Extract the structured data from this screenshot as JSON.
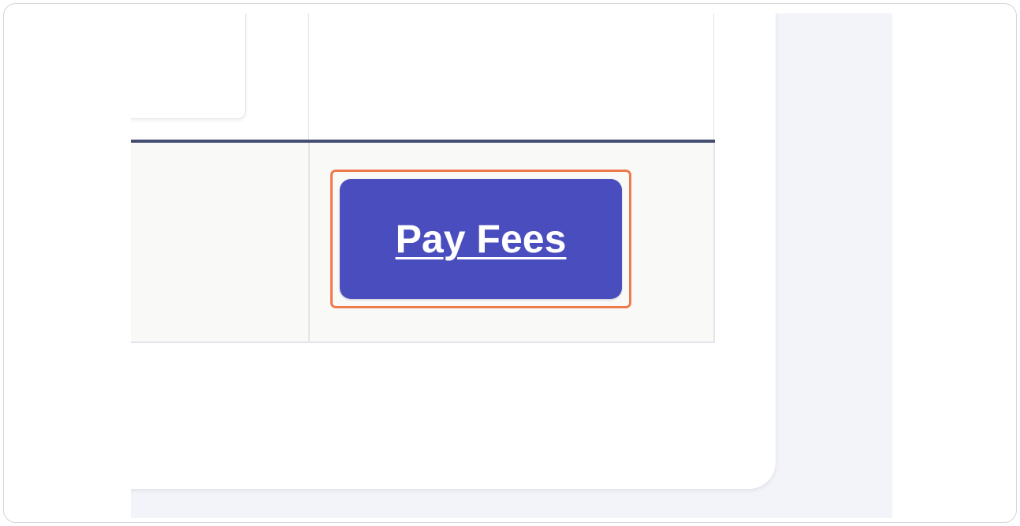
{
  "payment_row": {
    "pay_button_label": "Pay Fees"
  },
  "colors": {
    "button_bg": "#4a4dbd",
    "highlight_border": "#ec7a4a",
    "table_rule": "#454e71",
    "row_bg": "#f9f9f8",
    "page_bg": "#f3f4f9"
  }
}
